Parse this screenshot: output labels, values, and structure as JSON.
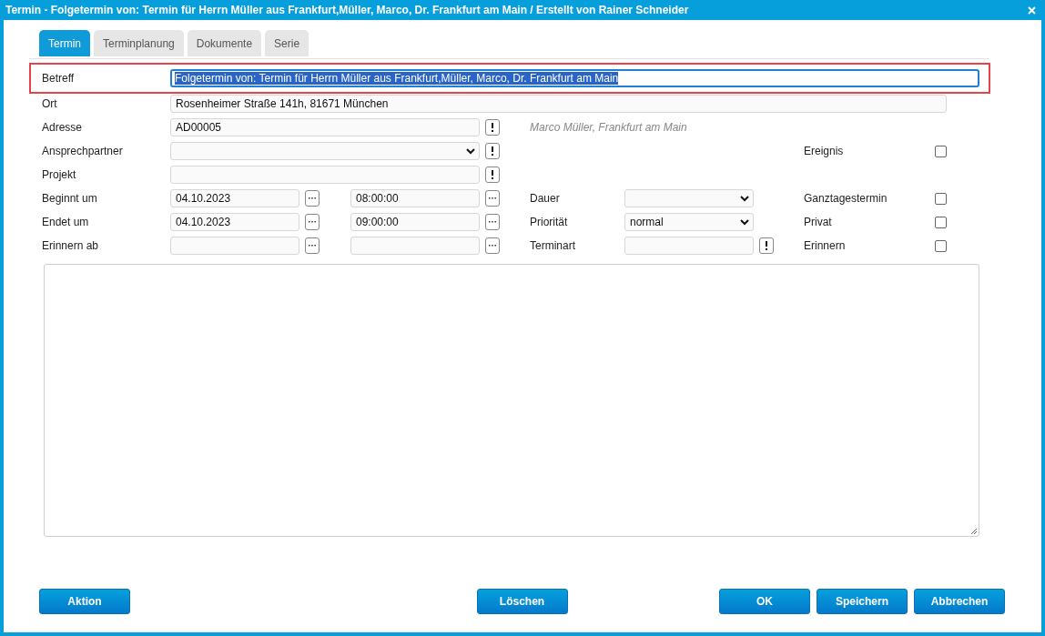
{
  "window": {
    "title": "Termin - Folgetermin von: Termin für Herrn Müller aus Frankfurt,Müller, Marco, Dr. Frankfurt am Main / Erstellt von Rainer Schneider"
  },
  "tabs": [
    {
      "label": "Termin",
      "selected": true
    },
    {
      "label": "Terminplanung",
      "selected": false
    },
    {
      "label": "Dokumente",
      "selected": false
    },
    {
      "label": "Serie",
      "selected": false
    }
  ],
  "form": {
    "subject": {
      "label": "Betreff",
      "value": "Folgetermin von: Termin für Herrn Müller aus Frankfurt,Müller, Marco, Dr. Frankfurt am Main",
      "highlighted": true,
      "text_selected": true
    },
    "location": {
      "label": "Ort",
      "value": "Rosenheimer Straße 141h, 81671 München"
    },
    "address": {
      "label": "Adresse",
      "value": "AD00005",
      "note": "Marco Müller, Frankfurt am Main"
    },
    "contact": {
      "label": "Ansprechpartner"
    },
    "project": {
      "label": "Projekt"
    },
    "start": {
      "label": "Beginnt um",
      "date": "04.10.2023",
      "time": "08:00:00"
    },
    "end": {
      "label": "Endet um",
      "date": "04.10.2023",
      "time": "09:00:00"
    },
    "reminder_from": {
      "label": "Erinnern ab"
    },
    "duration": {
      "label": "Dauer"
    },
    "priority": {
      "label": "Priorität",
      "value": "normal"
    },
    "appointment_type": {
      "label": "Terminart"
    },
    "flags": [
      {
        "label": "Ereignis",
        "checked": false
      },
      {
        "label": "Ganztagestermin",
        "checked": false
      },
      {
        "label": "Privat",
        "checked": false
      },
      {
        "label": "Erinnern",
        "checked": false
      }
    ]
  },
  "buttons": {
    "left": [
      "Aktion"
    ],
    "center": [
      "Löschen"
    ],
    "right": [
      "OK",
      "Speichern",
      "Abbrechen"
    ]
  }
}
